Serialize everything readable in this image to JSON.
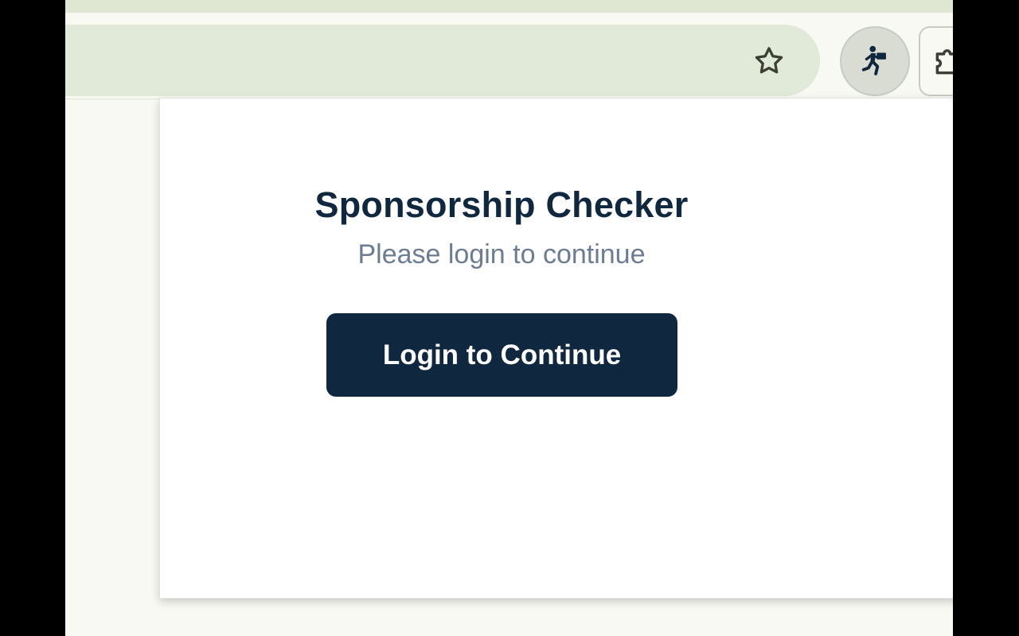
{
  "popup": {
    "title": "Sponsorship Checker",
    "subtitle": "Please login to continue",
    "login_button_label": "Login to Continue"
  },
  "toolbar": {
    "icons": [
      "star-icon",
      "running-person-icon",
      "puzzle-icon"
    ]
  },
  "colors": {
    "brand_navy": "#10283f",
    "subtitle_gray": "#6c7d93",
    "omnibox_bg": "#e1e9d8",
    "toolbar_bg": "#f8f9f2"
  }
}
